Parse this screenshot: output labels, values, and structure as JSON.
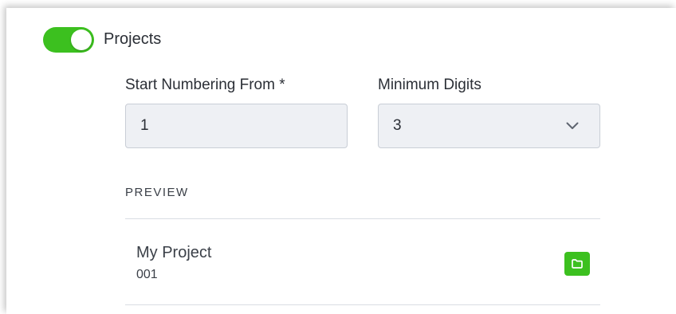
{
  "projects_toggle": {
    "label": "Projects",
    "enabled": true,
    "accent_color": "#3cc01f"
  },
  "start_numbering": {
    "label": "Start Numbering From *",
    "value": "1"
  },
  "minimum_digits": {
    "label": "Minimum Digits",
    "selected": "3",
    "icon": "chevron-down-icon"
  },
  "preview": {
    "heading": "PREVIEW",
    "item_name": "My Project",
    "item_number": "001",
    "icon": "folder-icon"
  }
}
